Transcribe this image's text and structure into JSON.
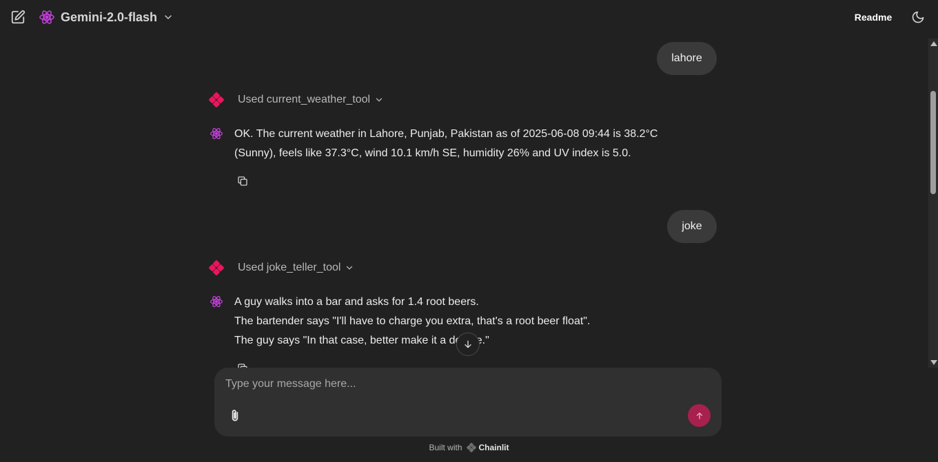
{
  "header": {
    "model_name": "Gemini-2.0-flash",
    "readme_label": "Readme",
    "icons": {
      "new_chat": "edit-icon",
      "model": "atom-icon",
      "dropdown": "chevron-down-icon",
      "theme": "moon-icon"
    }
  },
  "messages": [
    {
      "role": "user",
      "text": "lahore"
    },
    {
      "role": "tool",
      "label": "Used current_weather_tool"
    },
    {
      "role": "assistant",
      "lines": [
        "OK. The current weather in Lahore, Punjab, Pakistan as of 2025-06-08 09:44 is 38.2°C",
        "(Sunny), feels like 37.3°C, wind 10.1 km/h SE, humidity 26% and UV index is 5.0."
      ]
    },
    {
      "role": "user",
      "text": "joke"
    },
    {
      "role": "tool",
      "label": "Used joke_teller_tool"
    },
    {
      "role": "assistant",
      "lines": [
        "A guy walks into a bar and asks for 1.4 root beers.",
        "The bartender says \"I'll have to charge you extra, that's a root beer float\".",
        "The guy says \"In that case, better make it a double.\""
      ]
    }
  ],
  "composer": {
    "placeholder": "Type your message here...",
    "value": ""
  },
  "footer": {
    "built_with": "Built with",
    "brand": "Chainlit"
  },
  "colors": {
    "background": "#212121",
    "bubble": "#3a3a3a",
    "accent_pink": "#e8175d",
    "atom_purple": "#c13fd9",
    "send_button": "#a8204e"
  }
}
